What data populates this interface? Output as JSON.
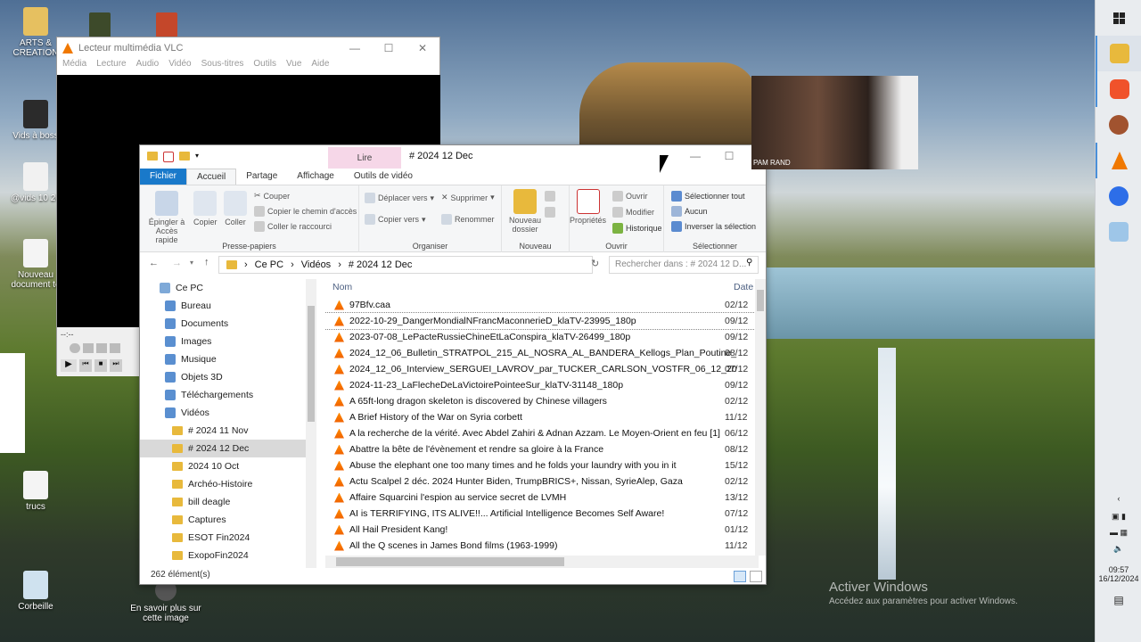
{
  "desktop": {
    "icons": [
      {
        "label": "ARTS & CREATION",
        "color": "#e6c060"
      },
      {
        "label": "Vids à boss",
        "color": "#2b2b2b"
      },
      {
        "label": "@vids 10 20",
        "color": "#f1f1f1"
      },
      {
        "label": "Nouveau document te",
        "color": "#f4f4f4"
      },
      {
        "label": "trucs",
        "color": "#f4f4f4"
      },
      {
        "label": "Corbeille",
        "color": "#cfe2ef"
      },
      {
        "label": "En savoir plus sur cette image",
        "color": "#555555"
      }
    ],
    "activation": {
      "title": "Activer Windows",
      "subtitle": "Accédez aux paramètres pour activer Windows."
    }
  },
  "vlc": {
    "title": "Lecteur multimédia VLC",
    "menu": [
      "Média",
      "Lecture",
      "Vidéo",
      "Audio",
      "Sous-titres",
      "Outils",
      "Vue",
      "Aide"
    ],
    "time": "--:--"
  },
  "explorer": {
    "title": "# 2024 12 Dec",
    "context_tab": "Lire",
    "tabs": [
      "Fichier",
      "Accueil",
      "Partage",
      "Affichage",
      "Outils de vidéo"
    ],
    "ribbon": {
      "pin": "Épingler à Accès rapide",
      "copy": "Copier",
      "paste": "Coller",
      "cut": "Couper",
      "copy_path": "Copier le chemin d'accès",
      "paste_shortcut": "Coller le raccourci",
      "g_clipboard": "Presse-papiers",
      "move_to": "Déplacer vers",
      "copy_to": "Copier vers",
      "delete": "Supprimer",
      "rename": "Renommer",
      "g_organize": "Organiser",
      "new_folder": "Nouveau dossier",
      "g_new": "Nouveau",
      "properties": "Propriétés",
      "open": "Ouvrir",
      "modify": "Modifier",
      "history": "Historique",
      "g_open": "Ouvrir",
      "select_all": "Sélectionner tout",
      "select_none": "Aucun",
      "invert": "Inverser la sélection",
      "g_select": "Sélectionner"
    },
    "breadcrumb": [
      "Ce PC",
      "Vidéos",
      "# 2024 12 Dec"
    ],
    "search_placeholder": "Rechercher dans : # 2024 12 D...",
    "nav": [
      {
        "label": "Ce PC",
        "indent": 0
      },
      {
        "label": "Bureau",
        "indent": 1
      },
      {
        "label": "Documents",
        "indent": 1
      },
      {
        "label": "Images",
        "indent": 1
      },
      {
        "label": "Musique",
        "indent": 1
      },
      {
        "label": "Objets 3D",
        "indent": 1
      },
      {
        "label": "Téléchargements",
        "indent": 1
      },
      {
        "label": "Vidéos",
        "indent": 1
      },
      {
        "label": "# 2024 11 Nov",
        "indent": 2
      },
      {
        "label": "# 2024 12 Dec",
        "indent": 2
      },
      {
        "label": "2024 10 Oct",
        "indent": 2
      },
      {
        "label": "Archéo-Histoire",
        "indent": 2
      },
      {
        "label": "bill deagle",
        "indent": 2
      },
      {
        "label": "Captures",
        "indent": 2
      },
      {
        "label": "ESOT Fin2024",
        "indent": 2
      },
      {
        "label": "ExopoFin2024",
        "indent": 2
      }
    ],
    "columns": {
      "name": "Nom",
      "date": "Date"
    },
    "files": [
      {
        "name": "97Bfv.caa",
        "date": "02/12"
      },
      {
        "name": "2022-10-29_DangerMondialNFrancMaconnerieD_klaTV-23995_180p",
        "date": "09/12"
      },
      {
        "name": "2023-07-08_LePacteRussieChineEtLaConspira_klaTV-26499_180p",
        "date": "09/12"
      },
      {
        "name": "2024_12_06_Bulletin_STRATPOL_215_AL_NOSRA_AL_BANDERA_Kellogs_Plan_Poutine_Bitcoin_...",
        "date": "08/12"
      },
      {
        "name": "2024_12_06_Interview_SERGUEI_LAVROV_par_TUCKER_CARLSON_VOSTFR_06_12_2024",
        "date": "07/12"
      },
      {
        "name": "2024-11-23_LaFlecheDeLaVictoirePointeeSur_klaTV-31148_180p",
        "date": "09/12"
      },
      {
        "name": "A 65ft-long dragon skeleton is discovered by Chinese villagers",
        "date": "02/12"
      },
      {
        "name": "A Brief History of the War on Syria corbett",
        "date": "11/12"
      },
      {
        "name": "A la recherche de la vérité. Avec Abdel Zahiri & Adnan Azzam. Le Moyen-Orient en feu [1]",
        "date": "06/12"
      },
      {
        "name": "Abattre la bête de l'évènement et rendre sa gloire à la France",
        "date": "08/12"
      },
      {
        "name": "Abuse the elephant one too many times and he folds your laundry with you in it",
        "date": "15/12"
      },
      {
        "name": "Actu Scalpel 2 déc. 2024  Hunter Biden, TrumpBRICS+, Nissan, SyrieAlep, Gaza",
        "date": "02/12"
      },
      {
        "name": "Affaire Squarcini  l'espion au service secret de LVMH",
        "date": "13/12"
      },
      {
        "name": "AI is TERRIFYING, ITS ALIVE!!... Artificial Intelligence Becomes Self Aware!",
        "date": "07/12"
      },
      {
        "name": "All Hail President Kang!",
        "date": "01/12"
      },
      {
        "name": "All the Q scenes in James Bond films (1963-1999)",
        "date": "11/12"
      }
    ],
    "status": "262 élément(s)"
  },
  "webcam": {
    "label": "PAM RAND"
  },
  "taskbar": {
    "time": "09:57",
    "date": "16/12/2024"
  }
}
